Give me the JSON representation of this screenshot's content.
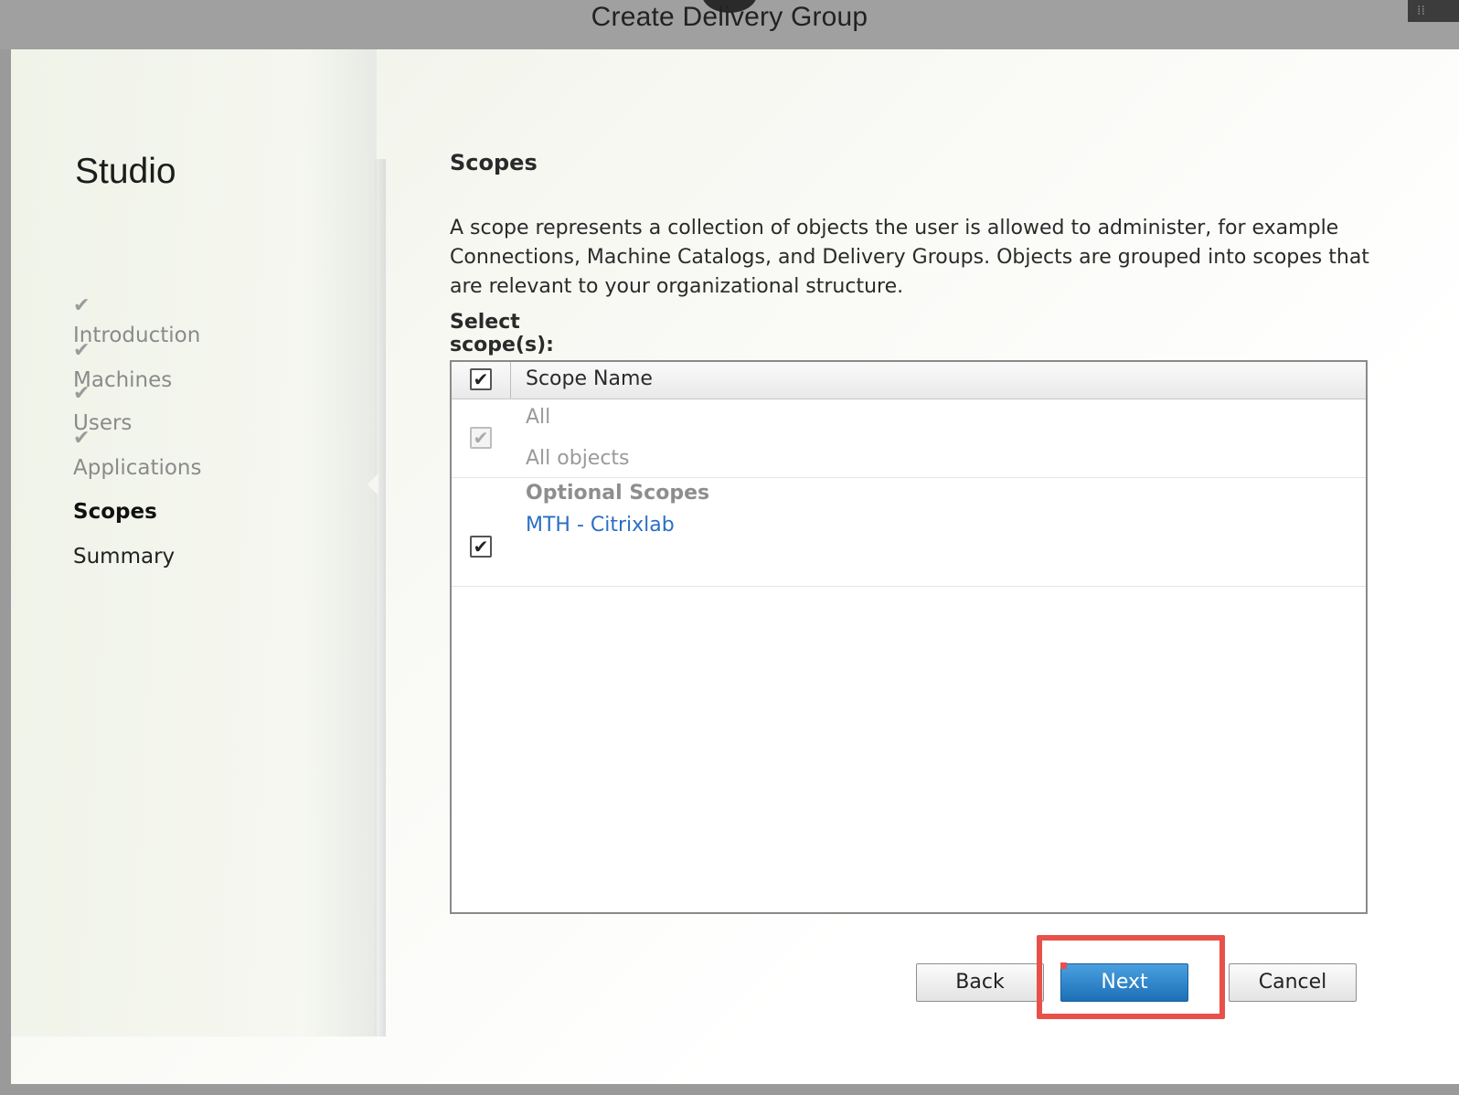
{
  "window": {
    "title": "Create Delivery Group",
    "corner_icon": "grid-icon"
  },
  "sidebar": {
    "brand": "Studio",
    "steps": [
      {
        "label": "Introduction",
        "state": "done"
      },
      {
        "label": "Machines",
        "state": "done"
      },
      {
        "label": "Users",
        "state": "done"
      },
      {
        "label": "Applications",
        "state": "done"
      },
      {
        "label": "Scopes",
        "state": "current"
      },
      {
        "label": "Summary",
        "state": "pending"
      }
    ],
    "check_glyph": "✔"
  },
  "main": {
    "heading": "Scopes",
    "description": "A scope represents a collection of objects the user is allowed to administer, for example Connections, Machine Catalogs, and Delivery Groups. Objects are grouped into scopes that are relevant to your organizational structure.",
    "select_label": "Select scope(s):",
    "table": {
      "header_checked": true,
      "column_header": "Scope Name",
      "rows": [
        {
          "name": "All",
          "detail": "All objects",
          "checked": true,
          "disabled": true
        },
        {
          "group_label": "Optional Scopes",
          "name": "MTH - Citrixlab",
          "checked": true,
          "disabled": false
        }
      ]
    }
  },
  "footer": {
    "back_label": "Back",
    "next_label": "Next",
    "cancel_label": "Cancel"
  },
  "colors": {
    "accent_blue": "#1c70b8",
    "link_blue": "#2a6fc4",
    "highlight_red": "#e8514a"
  }
}
